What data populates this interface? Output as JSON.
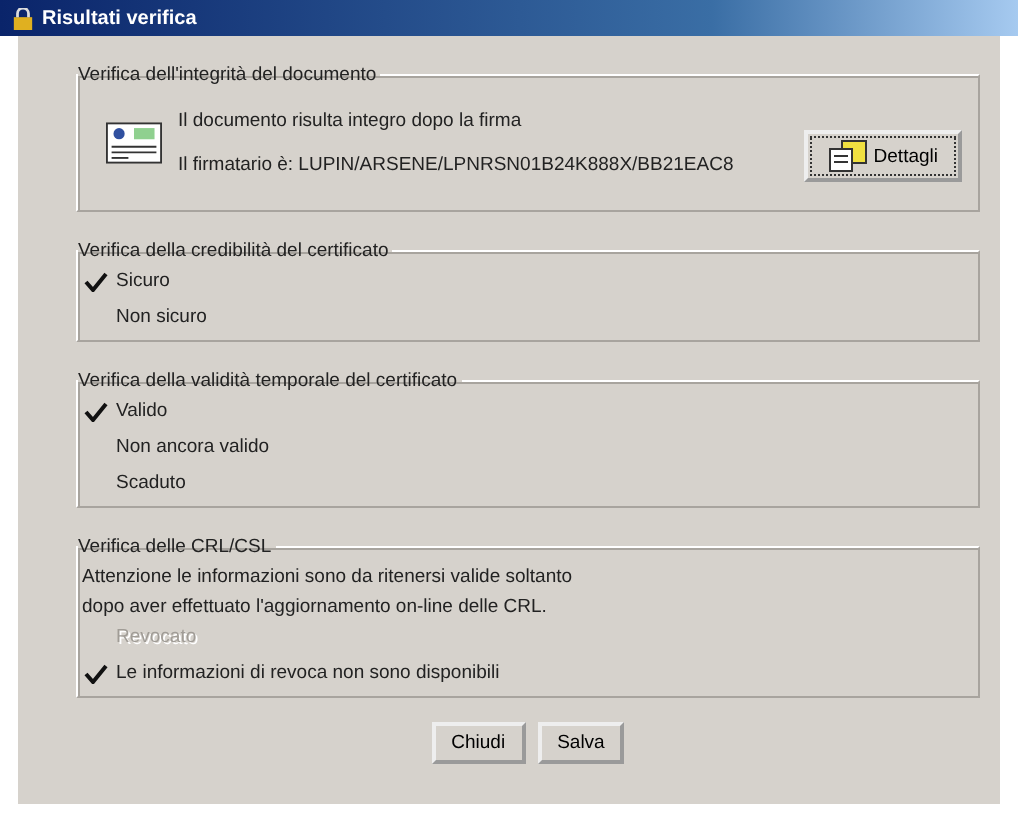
{
  "window": {
    "title": "Risultati verifica"
  },
  "integrity": {
    "title": "Verifica dell'integrità del documento",
    "message": "Il documento risulta integro dopo la firma",
    "signer": "Il firmatario è: LUPIN/ARSENE/LPNRSN01B24K888X/BB21EAC8",
    "details_button": "Dettagli"
  },
  "sections": [
    {
      "title": "Verifica della credibilità del certificato",
      "items": [
        {
          "label": "Sicuro",
          "checked": true,
          "disabled": false
        },
        {
          "label": "Non sicuro",
          "checked": false,
          "disabled": false
        }
      ]
    },
    {
      "title": "Verifica della validità temporale del certificato",
      "items": [
        {
          "label": "Valido",
          "checked": true,
          "disabled": false
        },
        {
          "label": "Non ancora valido",
          "checked": false,
          "disabled": false
        },
        {
          "label": "Scaduto",
          "checked": false,
          "disabled": false
        }
      ]
    },
    {
      "title": "Verifica delle CRL/CSL",
      "notes": [
        "Attenzione le informazioni sono da ritenersi valide soltanto",
        "dopo aver effettuato l'aggiornamento on-line delle CRL."
      ],
      "items": [
        {
          "label": "Revocato",
          "checked": false,
          "disabled": true
        },
        {
          "label": "Le informazioni di revoca non sono disponibili",
          "checked": true,
          "disabled": false
        }
      ]
    }
  ],
  "buttons": [
    "Chiudi",
    "Salva"
  ]
}
